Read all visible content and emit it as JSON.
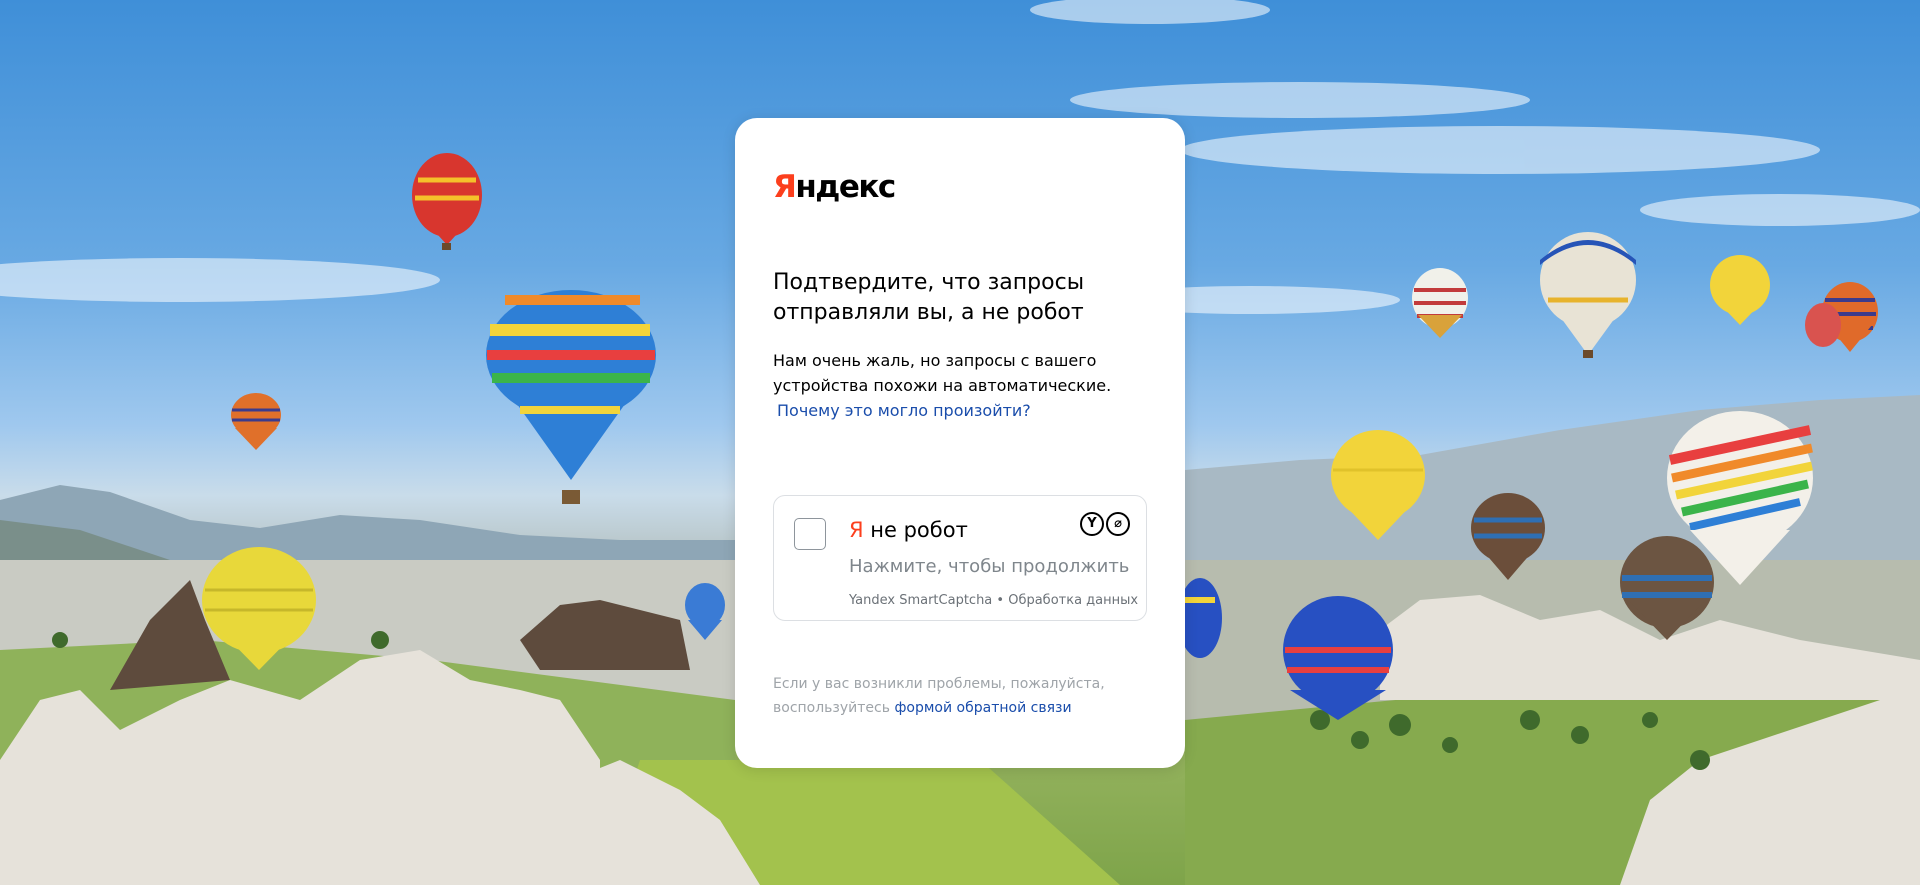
{
  "logo": {
    "first_letter": "Я",
    "rest": "ндекс"
  },
  "title": "Подтвердите, что запросы отправляли вы, а не робот",
  "description": {
    "text": "Нам очень жаль, но запросы с вашего устройства похожи на автоматические.",
    "link": "Почему это могло произойти?"
  },
  "captcha": {
    "label_ya": "Я",
    "label_rest": " не робот",
    "hint": "Нажмите, чтобы продолжить",
    "footer_brand": "Yandex SmartCaptcha",
    "footer_separator": " • ",
    "footer_link": "Обработка данных",
    "logo_1": "Y",
    "logo_2": "⌀",
    "checked": false
  },
  "help": {
    "text": "Если у вас возникли проблемы, пожалуйста, воспользуйтесь ",
    "link": "формой обратной связи"
  },
  "colors": {
    "brand_red": "#fc3f1d",
    "link_blue": "#1a4dab",
    "muted_text": "#9fa4a9"
  },
  "background": {
    "description_icon": "hot-air-balloons-landscape"
  }
}
